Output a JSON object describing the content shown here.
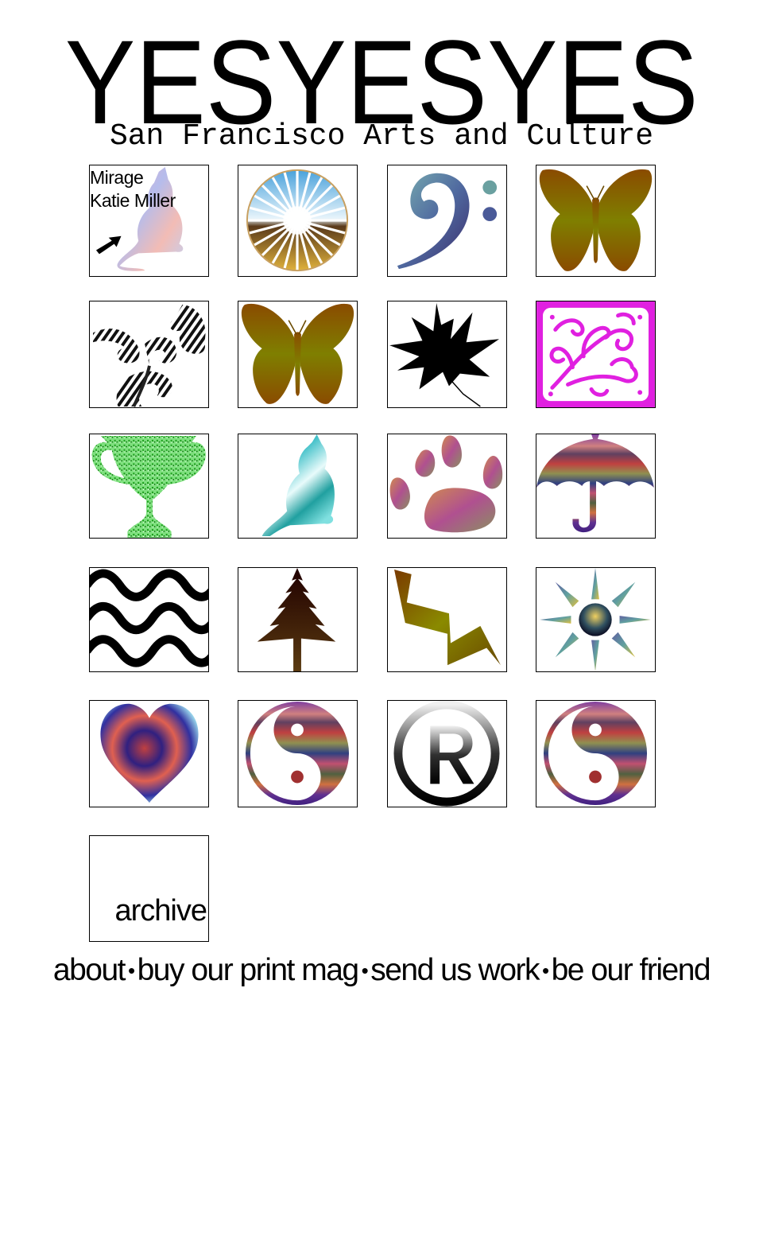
{
  "site": {
    "logo": "YESYESYES",
    "tagline": "San Francisco Arts and Culture"
  },
  "grid": {
    "tiles": [
      {
        "icon": "cat-icon",
        "caption_lines": [
          "Mirage",
          "Katie Miller"
        ]
      },
      {
        "icon": "sunburst-icon"
      },
      {
        "icon": "bass-clef-icon"
      },
      {
        "icon": "butterfly-icon"
      },
      {
        "icon": "ribbon-plant-icon"
      },
      {
        "icon": "butterfly-icon"
      },
      {
        "icon": "maple-leaf-icon"
      },
      {
        "icon": "celtic-knot-icon"
      },
      {
        "icon": "trophy-icon"
      },
      {
        "icon": "cat-icon"
      },
      {
        "icon": "paw-print-icon"
      },
      {
        "icon": "umbrella-icon"
      },
      {
        "icon": "waves-icon"
      },
      {
        "icon": "pine-tree-icon"
      },
      {
        "icon": "lightning-bolt-icon"
      },
      {
        "icon": "sun-icon"
      },
      {
        "icon": "heart-icon"
      },
      {
        "icon": "yin-yang-icon"
      },
      {
        "icon": "registered-mark-icon"
      },
      {
        "icon": "yin-yang-icon"
      }
    ],
    "archive_label": "archive"
  },
  "footer": {
    "links": [
      "about",
      "buy our print mag",
      "send us work",
      "be our friend"
    ],
    "separator": "•"
  },
  "colors": {
    "celtic_background": "#e020e0",
    "butterfly_top": "#8a4b00",
    "butterfly_bottom": "#7f7f00"
  }
}
